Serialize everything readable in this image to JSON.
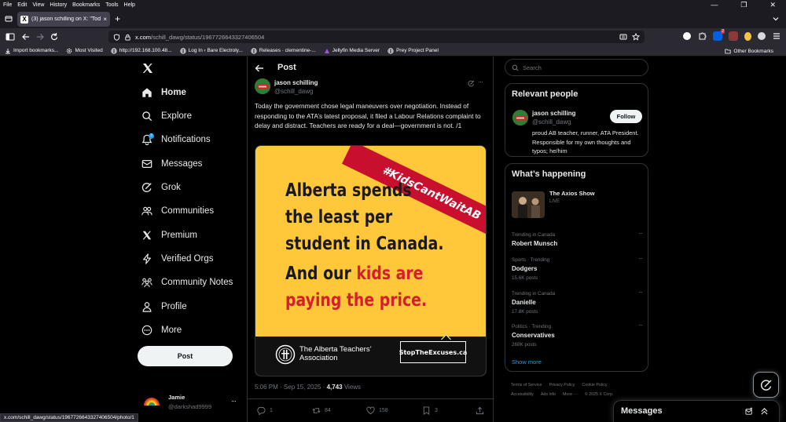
{
  "browser": {
    "menu": [
      "File",
      "Edit",
      "View",
      "History",
      "Bookmarks",
      "Tools",
      "Help"
    ],
    "tab": {
      "title": "(3) jason schilling on X: \"Today t",
      "favicon": "X",
      "close": "×"
    },
    "new_tab": "+",
    "window_controls": [
      "—",
      "❐",
      "✕"
    ],
    "url_host": "x.com",
    "url_rest": "/schill_dawg/status/1967726643327406504",
    "extension_badge": "2",
    "ext_colors": [
      "#ffffff",
      "#ff7139",
      "#8b8b99",
      "#e22850",
      "#f5c542",
      "#e8e8e8"
    ],
    "bookmarks": [
      "Import bookmarks...",
      "Most Visited",
      "http://192.168.100.48...",
      "Log In ‹ Bare Electroly...",
      "Releases · clementine-...",
      "Jellyfin Media Server",
      "Prey Project Panel"
    ],
    "other_bookmarks": "Other Bookmarks",
    "status_url": "x.com/schill_dawg/status/1967726643327406504/photo/1"
  },
  "nav": {
    "items": [
      {
        "label": "Home",
        "icon": "home-icon"
      },
      {
        "label": "Explore",
        "icon": "search-icon"
      },
      {
        "label": "Notifications",
        "icon": "bell-icon",
        "badge": "3"
      },
      {
        "label": "Messages",
        "icon": "mail-icon"
      },
      {
        "label": "Grok",
        "icon": "grok-icon"
      },
      {
        "label": "Communities",
        "icon": "people-icon"
      },
      {
        "label": "Premium",
        "icon": "x-icon"
      },
      {
        "label": "Verified Orgs",
        "icon": "lightning-icon"
      },
      {
        "label": "Community Notes",
        "icon": "community-notes-icon"
      },
      {
        "label": "Profile",
        "icon": "person-icon"
      },
      {
        "label": "More",
        "icon": "more-circle-icon"
      }
    ],
    "post_button": "Post",
    "account": {
      "name": "Jamie",
      "handle": "@darkshad9999",
      "more": "···"
    }
  },
  "post": {
    "header": "Post",
    "author_name": "jason schilling",
    "author_handle": "@schill_dawg",
    "more": "···",
    "text": "Today the government chose legal maneuvers over negotiation. Instead of responding to the ATA’s latest proposal, it filed a Labour Relations complaint to delay and distract. Teachers are ready for a deal—government is not. /1",
    "image": {
      "hashtag": "#KidsCantWaitAB",
      "lines": [
        "Alberta spends",
        "the least per",
        "student in Canada."
      ],
      "line4_prefix": "And our ",
      "line4_red": "kids are",
      "line5_red": "paying the price.",
      "org_name": "The Alberta Teachers’ Association",
      "slogan": "StopTheExcuses.ca",
      "yellow": "#ffc73a",
      "red": "#d31f2e"
    },
    "meta_time": "5:06 PM · Sep 15, 2025 · ",
    "meta_views": "4,743",
    "meta_views_label": " Views",
    "actions": {
      "replies": "1",
      "reposts": "84",
      "likes": "158",
      "bookmarks": "3"
    }
  },
  "sidebar": {
    "search_placeholder": "Search",
    "relevant_title": "Relevant people",
    "relevant": {
      "name": "jason schilling",
      "handle": "@schill_dawg",
      "follow": "Follow",
      "bio": "proud AB teacher, runner, ATA President. Responsible for my own thoughts and typos; he/him"
    },
    "happening_title": "What’s happening",
    "axios": {
      "title": "The Axios Show",
      "status": "LIVE"
    },
    "trends": [
      {
        "context": "Trending in Canada",
        "name": "Robert Munsch",
        "count": ""
      },
      {
        "context": "Sports · Trending",
        "name": "Dodgers",
        "count": "15.6K posts"
      },
      {
        "context": "Trending in Canada",
        "name": "Danielle",
        "count": "17.8K posts"
      },
      {
        "context": "Politics · Trending",
        "name": "Conservatives",
        "count": "268K posts"
      }
    ],
    "trend_more": "···",
    "show_more": "Show more",
    "footer": [
      "Terms of Service",
      "Privacy Policy",
      "Cookie Policy",
      "Accessibility",
      "Ads info",
      "More ···",
      "© 2025 X Corp."
    ]
  },
  "messages_drawer": {
    "title": "Messages"
  },
  "colors": {
    "accent": "#1d9bf0",
    "border": "#2f3336",
    "muted": "#71767b"
  }
}
